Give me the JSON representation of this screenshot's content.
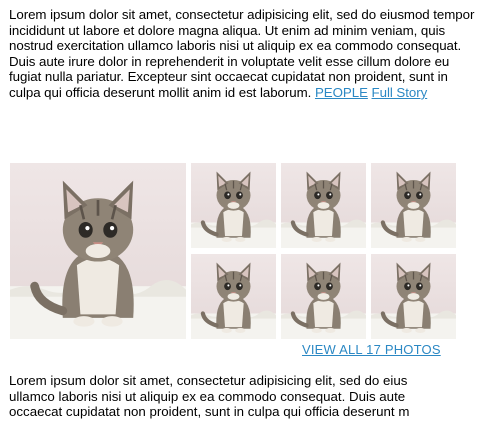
{
  "article": {
    "paragraph1": "Lorem ipsum dolor sit amet, consectetur adipisicing elit, sed do eiusmod tempor incididunt ut labore et dolore magna aliqua. Ut enim ad minim veniam, quis nostrud exercitation ullamco laboris nisi ut aliquip ex ea commodo consequat. Duis aute irure dolor in reprehenderit in voluptate velit esse cillum dolore eu fugiat nulla pariatur. Excepteur sint occaecat cupidatat non proident, sunt in culpa qui officia deserunt mollit anim id est laborum.",
    "link_people": "PEOPLE",
    "link_full_story": "Full Story",
    "paragraph2_lines": [
      "Lorem ipsum dolor sit amet, consectetur adipisicing elit, sed do eius",
      "ullamco laboris nisi ut aliquip ex ea commodo consequat. Duis aute",
      "occaecat cupidatat non proident, sunt in culpa qui officia deserunt m"
    ]
  },
  "gallery": {
    "view_all": "VIEW ALL 17 PHOTOS",
    "photo_names": [
      "kitten-photo"
    ]
  },
  "colors": {
    "link": "#2b88c4",
    "photo_background": "#e9dfe0",
    "rug": "#f4f3ef",
    "kitten_fur": "#8a7f72"
  }
}
